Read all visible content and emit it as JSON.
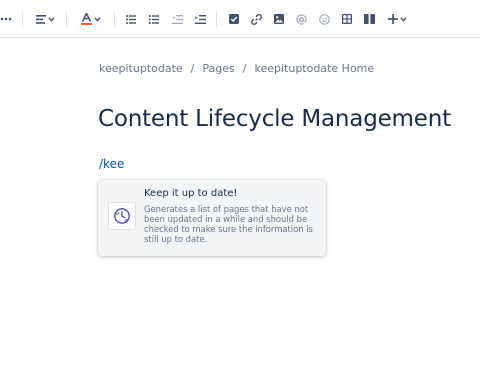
{
  "toolbar": {
    "items": [
      "more-options",
      "text-alignment",
      "text-color",
      "bullet-list",
      "numbered-list",
      "outdent",
      "indent",
      "action-item",
      "link",
      "image",
      "mention",
      "emoji",
      "table",
      "layouts",
      "insert-more"
    ],
    "colors": {
      "icon": "#42526E",
      "text_color_underline": "#FF5630",
      "divider": "#DFE1E6"
    }
  },
  "breadcrumb": {
    "items": [
      "keepituptodate",
      "Pages",
      "keepituptodate Home"
    ],
    "separator": "/"
  },
  "page": {
    "title": "Content Lifecycle Management",
    "slash_command": "/kee"
  },
  "macro_suggestion": {
    "title": "Keep it up to date!",
    "description": "Generates a list of pages that have not been updated in a while and should be checked to make sure the information is still up to date.",
    "icon": "clock-globe-icon"
  },
  "colors": {
    "text_primary": "#172B4D",
    "text_secondary": "#6B778C",
    "link": "#0052CC",
    "popup_bg": "#F4F5F7",
    "icon_accent": "#3F4AB3"
  }
}
